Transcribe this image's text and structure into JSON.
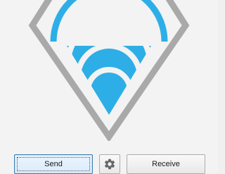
{
  "window": {
    "logo": "superbeam-diamond-wifi-logo",
    "accent_color": "#2eaee6",
    "outline_color": "#a9a9a9"
  },
  "buttons": {
    "send_label": "Send",
    "settings_icon": "gear-icon",
    "receive_label": "Receive"
  }
}
